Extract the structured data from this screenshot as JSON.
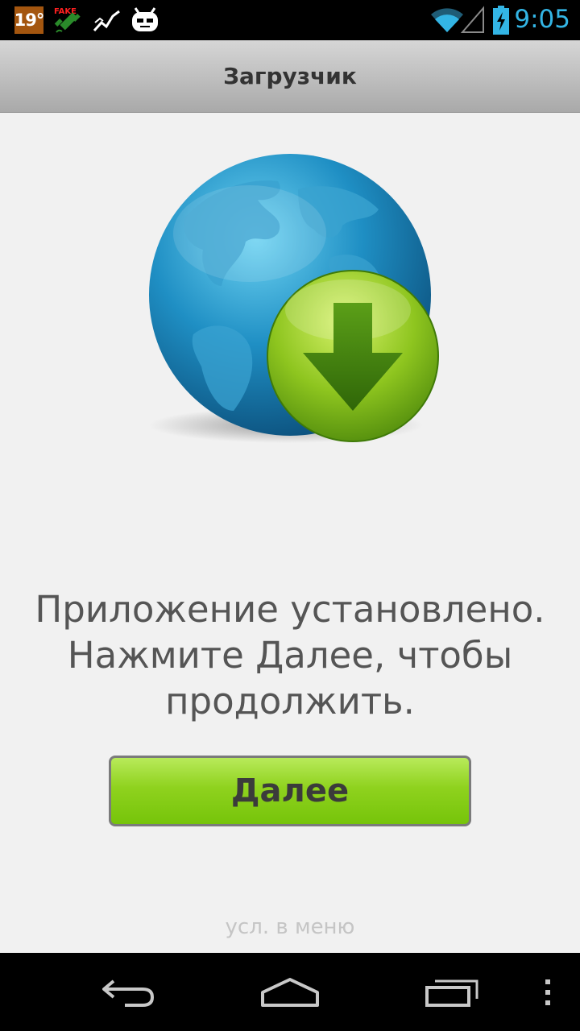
{
  "status_bar": {
    "temperature": "19°",
    "fake_label": "FAKE",
    "time": "9:05",
    "icons": [
      "weather-temp-icon",
      "fake-gps-icon",
      "activity-graph-icon",
      "cyanogen-mascot-icon",
      "wifi-icon",
      "signal-icon",
      "battery-charging-icon"
    ]
  },
  "action_bar": {
    "title": "Загрузчик"
  },
  "main": {
    "hero_icon": "globe-download-icon",
    "message_lines": [
      "Приложение установлено.",
      "Нажмите Далее, чтобы",
      "продолжить."
    ],
    "next_button_label": "Далее",
    "terms_text": "усл. в меню"
  },
  "nav_bar": {
    "buttons": [
      "back-icon",
      "home-icon",
      "recent-apps-icon",
      "overflow-menu-icon"
    ]
  },
  "colors": {
    "accent": "#33b5e5",
    "button_green": "#8fd21e",
    "background": "#f1f1f1"
  }
}
